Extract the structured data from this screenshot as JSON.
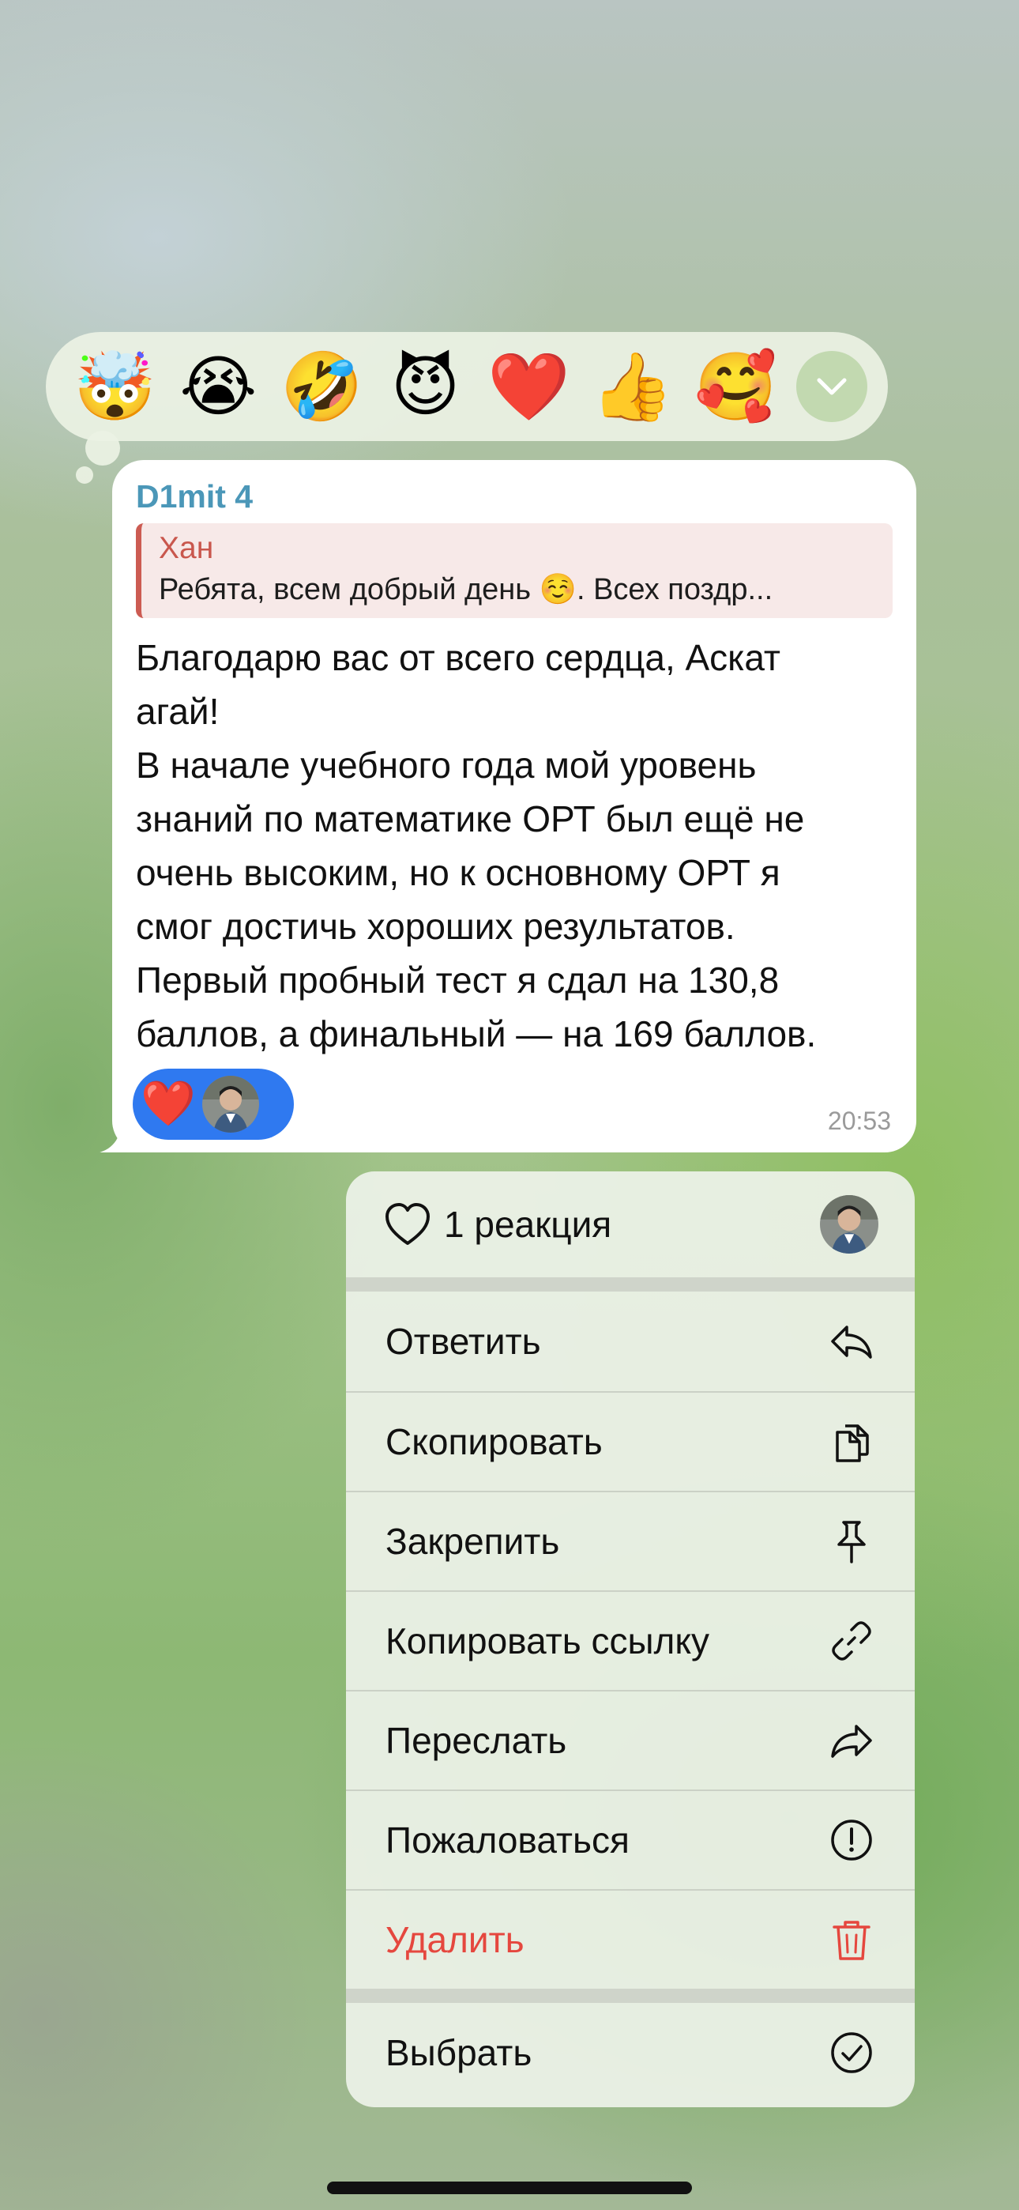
{
  "reaction_bar": {
    "reactions": [
      {
        "emoji": "🤯",
        "name": "exploding-head"
      },
      {
        "emoji": "😭",
        "name": "crying-face"
      },
      {
        "emoji": "🤣",
        "name": "rofl-face"
      },
      {
        "emoji": "😈",
        "name": "devil-face"
      },
      {
        "emoji": "❤️",
        "name": "heart"
      },
      {
        "emoji": "👍",
        "name": "thumbs-up"
      },
      {
        "emoji": "🥰",
        "name": "smiling-hearts-face"
      }
    ],
    "expand_icon": "chevron-down-icon"
  },
  "message": {
    "sender": "D1mit 4",
    "reply": {
      "name": "Хан",
      "text": "Ребята, всем добрый день ☺️. Всех поздр..."
    },
    "text": "Благодарю вас от всего сердца, Аскат\nагай!\nВ начале учебного года мой уровень\nзнаний по математике ОРТ был ещё не\nочень высоким, но к основному ОРТ я\nсмог достичь хороших результатов.\nПервый пробный тест я сдал на 130,8\nбаллов, а финальный — на 169 баллов.",
    "reaction": {
      "emoji": "❤️"
    },
    "time": "20:53"
  },
  "menu": {
    "reactions_label": "1 реакция",
    "items": [
      {
        "label": "Ответить",
        "icon": "reply-icon"
      },
      {
        "label": "Скопировать",
        "icon": "copy-icon"
      },
      {
        "label": "Закрепить",
        "icon": "pin-icon"
      },
      {
        "label": "Копировать ссылку",
        "icon": "link-icon"
      },
      {
        "label": "Переслать",
        "icon": "forward-icon"
      },
      {
        "label": "Пожаловаться",
        "icon": "report-icon"
      },
      {
        "label": "Удалить",
        "icon": "trash-icon"
      }
    ],
    "select_label": "Выбрать",
    "colors": {
      "destructive": "#e5473e",
      "accent": "#2f79f0"
    }
  }
}
